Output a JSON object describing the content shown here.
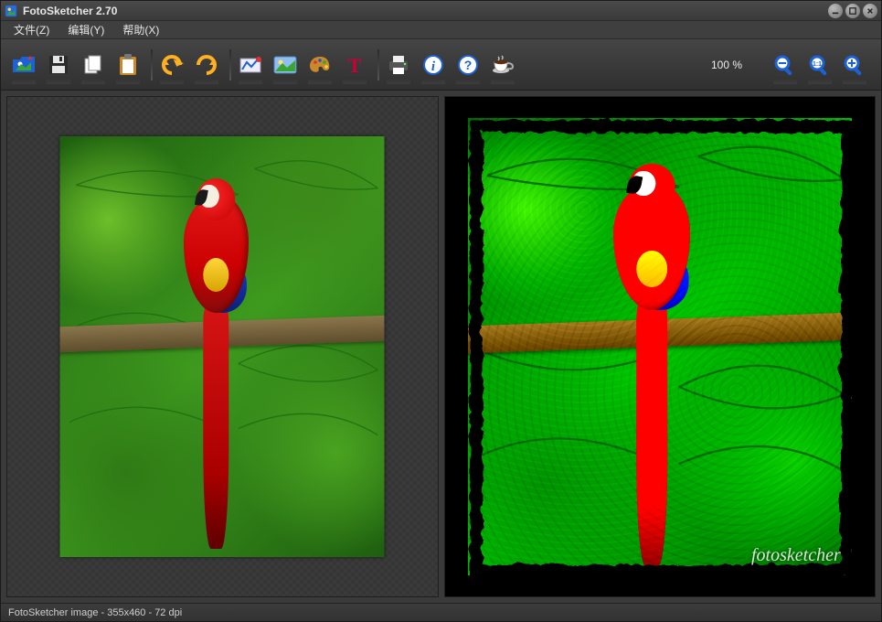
{
  "window": {
    "title": "FotoSketcher 2.70",
    "minimize_tip": "Minimize",
    "maximize_tip": "Maximize",
    "close_tip": "Close"
  },
  "menus": {
    "file": "文件(Z)",
    "edit": "编辑(Y)",
    "help": "帮助(X)"
  },
  "toolbar": {
    "open": {
      "name": "open-image-button"
    },
    "save": {
      "name": "save-image-button"
    },
    "copy": {
      "name": "copy-button"
    },
    "paste": {
      "name": "paste-button"
    },
    "undo": {
      "name": "undo-button"
    },
    "redo": {
      "name": "redo-button"
    },
    "params": {
      "name": "drawing-parameters-button"
    },
    "source": {
      "name": "source-image-button"
    },
    "palette": {
      "name": "palette-button"
    },
    "text": {
      "name": "add-text-button"
    },
    "print": {
      "name": "print-button"
    },
    "info": {
      "name": "info-button"
    },
    "helpb": {
      "name": "help-button"
    },
    "donate": {
      "name": "donate-coffee-button"
    }
  },
  "zoom": {
    "label": "100 %",
    "out": {
      "name": "zoom-out-button"
    },
    "fit": {
      "name": "zoom-fit-button"
    },
    "in": {
      "name": "zoom-in-button"
    }
  },
  "canvas": {
    "signature": "fotosketcher"
  },
  "status": {
    "text": "FotoSketcher image - 355x460 - 72 dpi"
  },
  "colors": {
    "accent_red": "#d81515",
    "accent_blue": "#1c62d6",
    "bg": "#3f3f3f"
  }
}
